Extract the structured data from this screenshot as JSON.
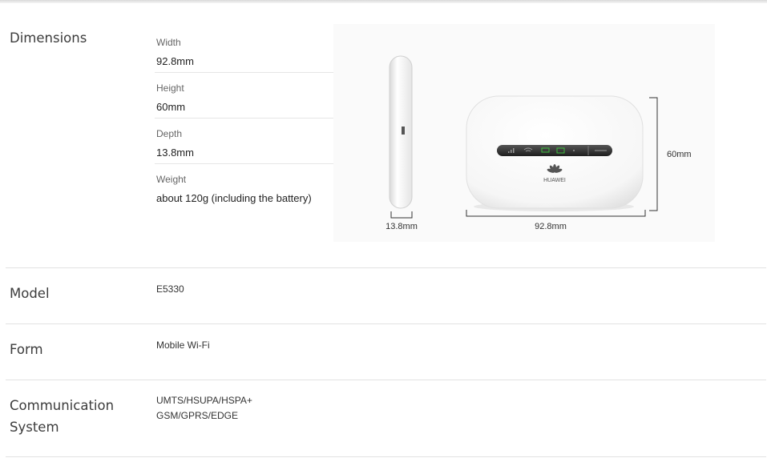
{
  "sections": {
    "dimensions": {
      "title": "Dimensions",
      "specs": [
        {
          "label": "Width",
          "value": "92.8mm"
        },
        {
          "label": "Height",
          "value": "60mm"
        },
        {
          "label": "Depth",
          "value": "13.8mm"
        },
        {
          "label": "Weight",
          "value": "about 120g (including the battery)"
        }
      ],
      "figure": {
        "side_label": "13.8mm",
        "width_label": "92.8mm",
        "height_label": "60mm",
        "brand": "HUAWEI"
      }
    },
    "model": {
      "title": "Model",
      "value": "E5330"
    },
    "form": {
      "title": "Form",
      "value": "Mobile Wi-Fi"
    },
    "communication": {
      "title_line1": "Communication",
      "title_line2": "System",
      "lines": [
        "UMTS/HSUPA/HSPA+",
        "GSM/GPRS/EDGE"
      ]
    }
  },
  "colors": {
    "divider": "#e2e2e2",
    "indicator_green": "#3fbf3f"
  },
  "icons": [
    "signal-icon",
    "wifi-icon",
    "battery-icon",
    "message-icon",
    "huawei-logo-icon"
  ]
}
